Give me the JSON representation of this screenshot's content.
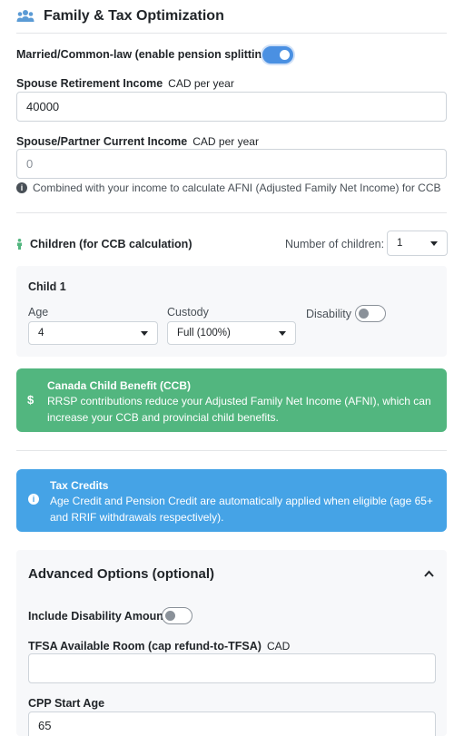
{
  "header": {
    "title": "Family & Tax Optimization",
    "icon": "family-icon"
  },
  "married": {
    "label": "Married/Common-law (enable pension splitting)",
    "enabled": true
  },
  "spouse_retirement": {
    "label": "Spouse Retirement Income",
    "unit": "CAD per year",
    "value": "40000"
  },
  "spouse_current": {
    "label": "Spouse/Partner Current Income",
    "unit": "CAD per year",
    "placeholder": "0",
    "help": "Combined with your income to calculate AFNI (Adjusted Family Net Income) for CCB"
  },
  "children": {
    "title": "Children (for CCB calculation)",
    "count_label": "Number of children:",
    "count": "1"
  },
  "child1": {
    "title": "Child 1",
    "age_label": "Age",
    "age": "4",
    "custody_label": "Custody",
    "custody": "Full (100%)",
    "disability_label": "Disability",
    "disability": false
  },
  "ccb_alert": {
    "title": "Canada Child Benefit (CCB)",
    "text": "RRSP contributions reduce your Adjusted Family Net Income (AFNI), which can increase your CCB and provincial child benefits.",
    "icon": "dollar-icon",
    "color": "#52b67f"
  },
  "tax_alert": {
    "title": "Tax Credits",
    "text": "Age Credit and Pension Credit are automatically applied when eligible (age 65+ and RRIF withdrawals respectively).",
    "icon": "info-icon",
    "color": "#45a3e6"
  },
  "advanced": {
    "title": "Advanced Options (optional)",
    "disability_label": "Include Disability Amount",
    "disability": false,
    "tfsa_label": "TFSA Available Room (cap refund-to-TFSA)",
    "tfsa_unit": "CAD",
    "tfsa_value": "",
    "cpp_label": "CPP Start Age",
    "cpp_value": "65"
  }
}
